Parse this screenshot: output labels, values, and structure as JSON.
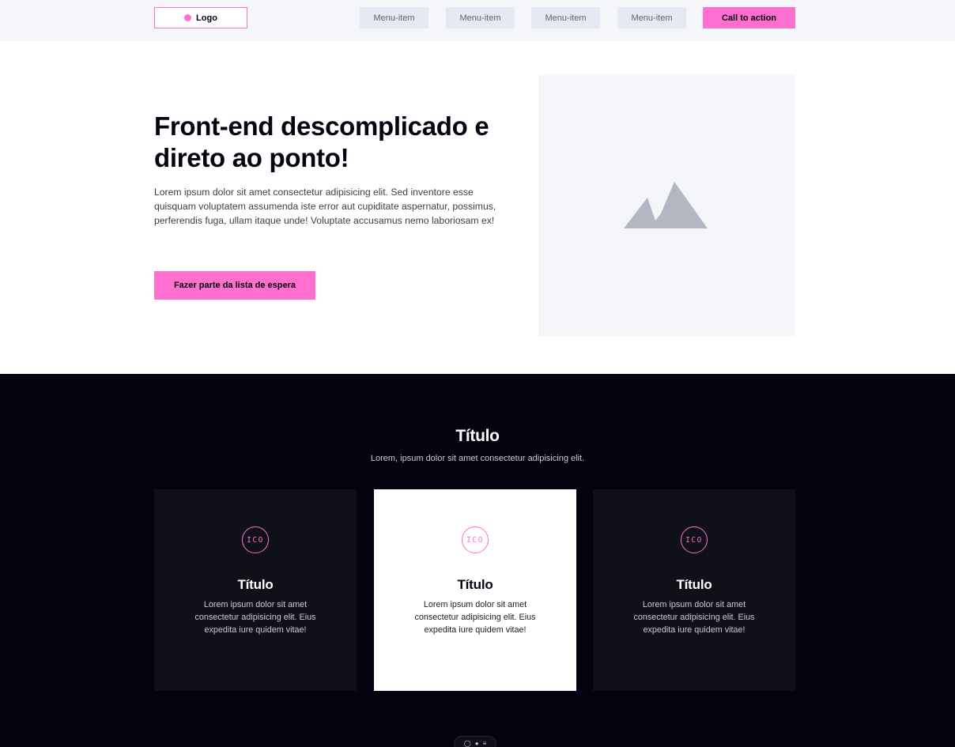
{
  "header": {
    "logo_label": "Logo",
    "menu": [
      "Menu-item",
      "Menu-item",
      "Menu-item",
      "Menu-item"
    ],
    "cta_label": "Call to action"
  },
  "hero": {
    "title": "Front-end descomplicado e direto ao ponto!",
    "text": "Lorem ipsum dolor sit amet consectetur adipisicing elit. Sed inventore esse quisquam voluptatem assumenda iste error aut cupiditate aspernatur, possimus, perferendis fuga, ullam itaque unde! Voluptate accusamus nemo laboriosam ex!",
    "button_label": "Fazer parte da lista de espera",
    "image_icon": "mountain-image-placeholder-icon"
  },
  "features": {
    "title": "Título",
    "subtitle": "Lorem, ipsum dolor sit amet consectetur adipisicing elit.",
    "cards": [
      {
        "icon_label": "ICO",
        "title": "Título",
        "text": "Lorem ipsum dolor sit amet consectetur adipisicing elit. Eius expedita iure quidem vitae!"
      },
      {
        "icon_label": "ICO",
        "title": "Título",
        "text": "Lorem ipsum dolor sit amet consectetur adipisicing elit. Eius expedita iure quidem vitae!"
      },
      {
        "icon_label": "ICO",
        "title": "Título",
        "text": "Lorem ipsum dolor sit amet consectetur adipisicing elit. Eius expedita iure quidem vitae!"
      }
    ]
  },
  "toolbar": {
    "icons": [
      "chat-icon",
      "palette-icon",
      "menu-icon"
    ]
  },
  "colors": {
    "accent": "#ff6fcf",
    "dark_bg": "#05030f",
    "card_bg": "#101019",
    "header_bg": "#f5f6f9",
    "menu_bg": "#e5eaf2"
  }
}
